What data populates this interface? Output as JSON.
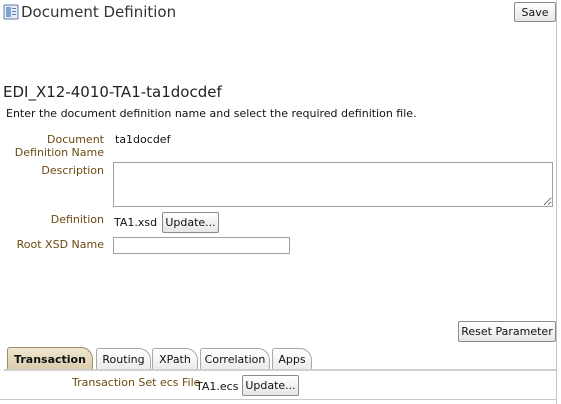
{
  "header": {
    "title": "Document Definition",
    "save_label": "Save",
    "icon": "document-icon"
  },
  "document": {
    "heading": "EDI_X12-4010-TA1-ta1docdef",
    "instructions": "Enter the document definition name and select the required definition file."
  },
  "form": {
    "docname_label_line1": "Document",
    "docname_label_line2": "Definition Name",
    "docname_value": "ta1docdef",
    "description_label": "Description",
    "description_value": "",
    "definition_label": "Definition",
    "definition_value": "TA1.xsd",
    "update_label": "Update...",
    "root_xsd_label": "Root XSD Name",
    "root_xsd_value": ""
  },
  "reset_label": "Reset Parameter",
  "tabs": [
    {
      "label": "Transaction",
      "active": true
    },
    {
      "label": "Routing",
      "active": false
    },
    {
      "label": "XPath",
      "active": false
    },
    {
      "label": "Correlation",
      "active": false
    },
    {
      "label": "Apps",
      "active": false
    }
  ],
  "transaction": {
    "ecs_label": "Transaction Set ecs File",
    "ecs_value": "TA1.ecs",
    "update_label": "Update..."
  }
}
